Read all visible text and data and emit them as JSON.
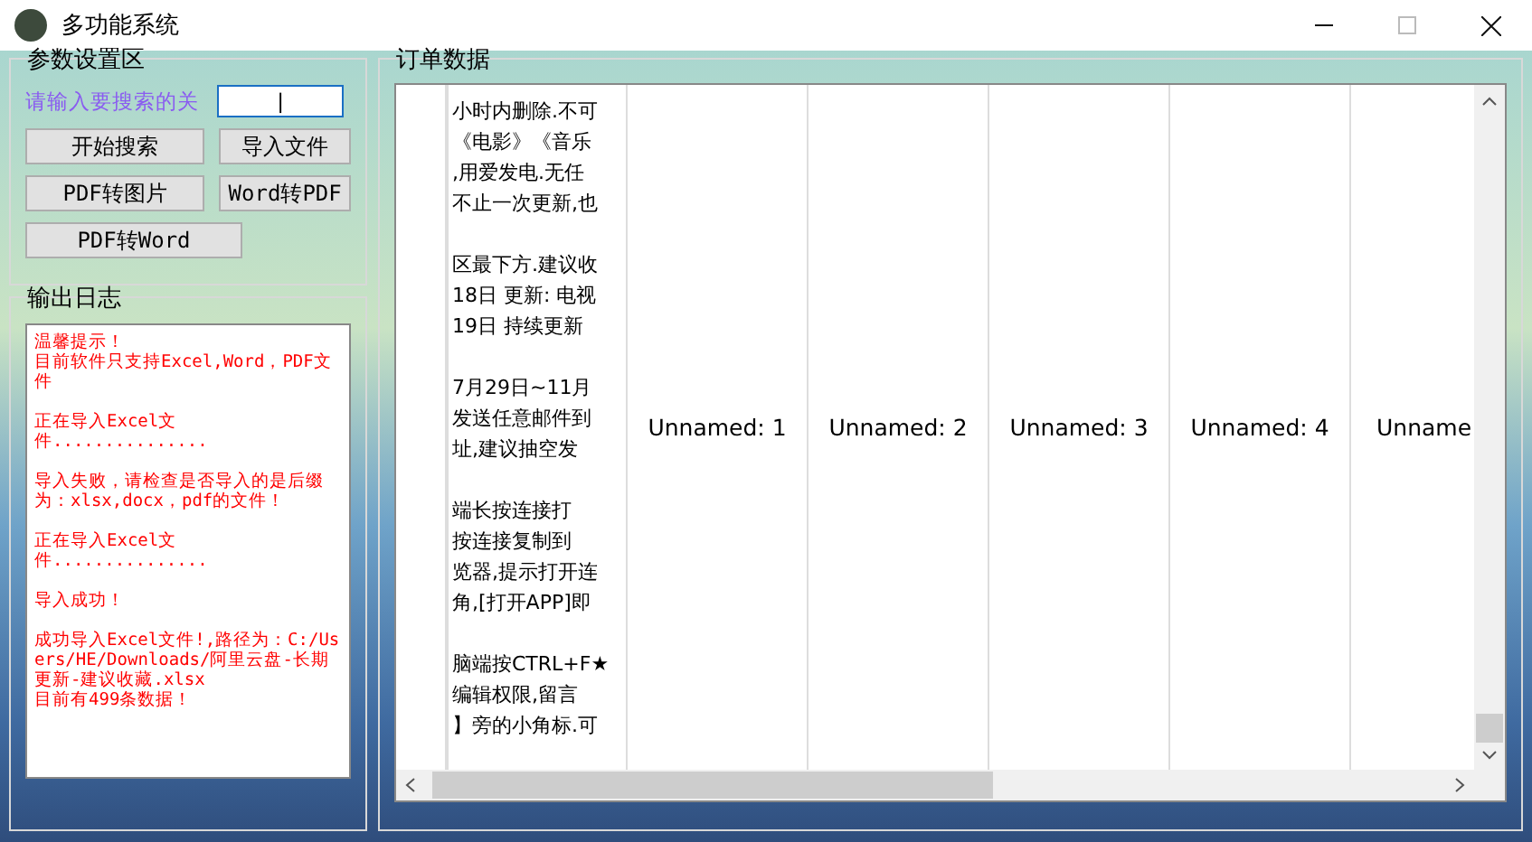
{
  "window": {
    "title": "多功能系统",
    "maximize_disabled": true
  },
  "settings": {
    "title": "参数设置区",
    "search_label": "请输入要搜索的关",
    "search_value": "|",
    "buttons": [
      "开始搜索",
      "导入文件",
      "PDF转图片",
      "Word转PDF",
      "PDF转Word"
    ]
  },
  "log": {
    "title": "输出日志",
    "paragraphs": [
      [
        "温馨提示！",
        "目前软件只支持Excel,Word，PDF文件"
      ],
      [
        "正在导入Excel文件..............."
      ],
      [
        "导入失败，请检查是否导入的是后缀为：xlsx,docx，pdf的文件！"
      ],
      [
        "正在导入Excel文件..............."
      ],
      [
        "导入成功！"
      ],
      [
        "成功导入Excel文件!,路径为：C:/Users/HE/Downloads/阿里云盘-长期更新-建议收藏.xlsx",
        "目前有499条数据！"
      ]
    ]
  },
  "table": {
    "title": "订单数据",
    "text_cell": [
      [
        "小时内删除.不可",
        "《电影》《音乐",
        ",用爱发电.无任",
        "不止一次更新,也"
      ],
      [
        "区最下方.建议收",
        "18日 更新: 电视",
        "19日 持续更新"
      ],
      [
        "7月29日~11月",
        "发送任意邮件到",
        "址,建议抽空发"
      ],
      [
        "端长按连接打",
        "按连接复制到",
        "览器,提示打开连",
        "角,[打开APP]即"
      ],
      [
        "脑端按CTRL+F★",
        "编辑权限,留言",
        "】旁的小角标.可"
      ]
    ],
    "columns": [
      "Unnamed: 1",
      "Unnamed: 2",
      "Unnamed: 3",
      "Unnamed: 4",
      "Unname"
    ]
  }
}
